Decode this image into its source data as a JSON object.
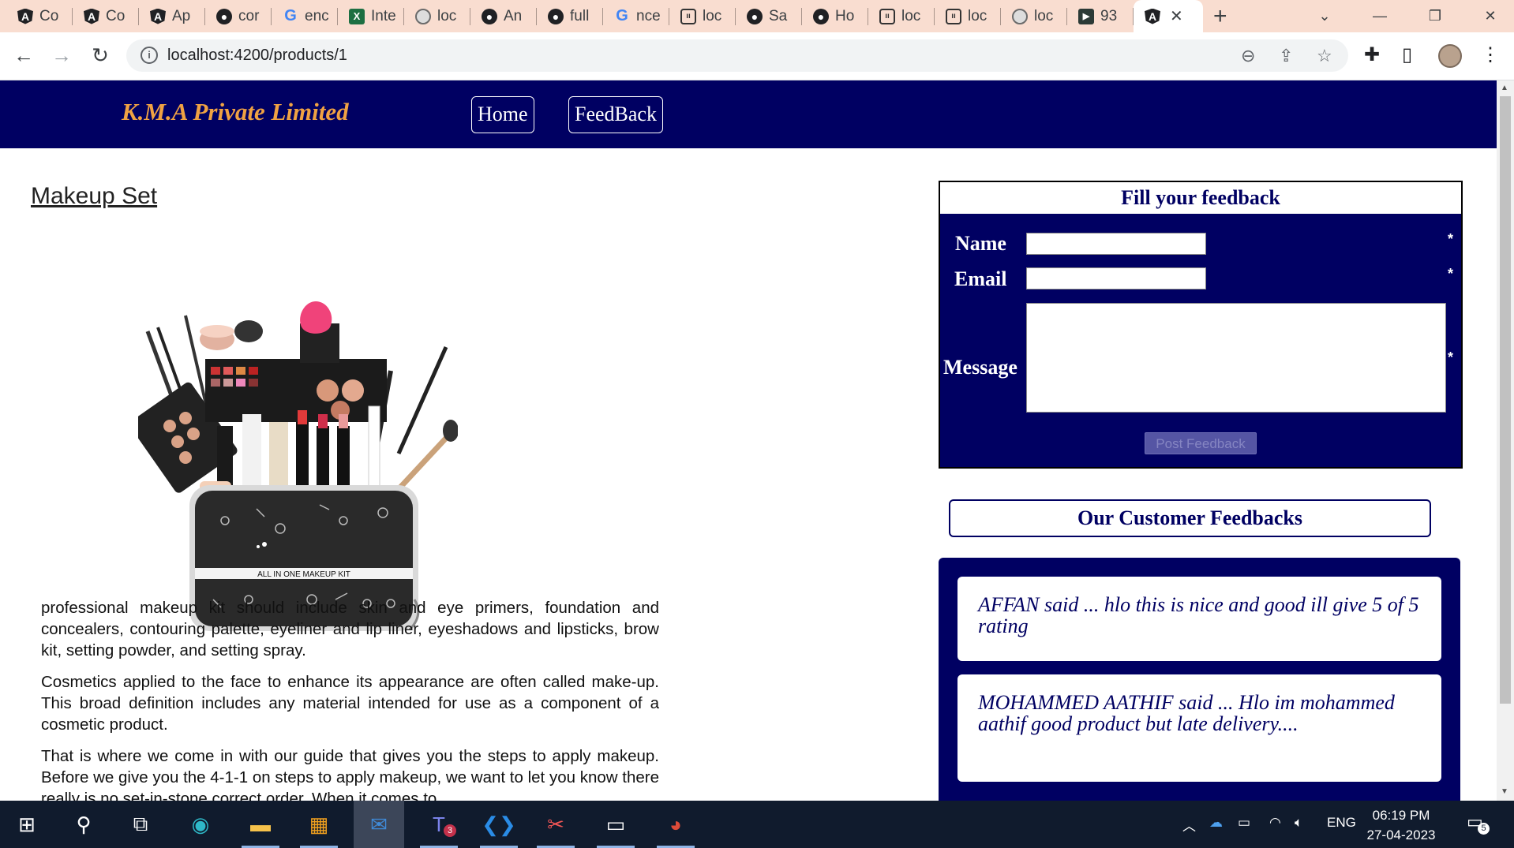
{
  "browser": {
    "tabs": [
      {
        "icon": "angular-icon",
        "label": "Co"
      },
      {
        "icon": "angular-icon",
        "label": "Co"
      },
      {
        "icon": "angular-icon",
        "label": "Ap"
      },
      {
        "icon": "github-icon",
        "label": "cor"
      },
      {
        "icon": "google-icon",
        "label": "enc"
      },
      {
        "icon": "excel-icon",
        "label": "Inte"
      },
      {
        "icon": "globe-icon",
        "label": "loc"
      },
      {
        "icon": "github-icon",
        "label": "An"
      },
      {
        "icon": "github-icon",
        "label": "full"
      },
      {
        "icon": "google-icon",
        "label": "nce"
      },
      {
        "icon": "robot-icon",
        "label": "loc"
      },
      {
        "icon": "github-icon",
        "label": "Sa"
      },
      {
        "icon": "github-icon",
        "label": "Ho"
      },
      {
        "icon": "robot-icon",
        "label": "loc"
      },
      {
        "icon": "robot-icon",
        "label": "loc"
      },
      {
        "icon": "globe-icon",
        "label": "loc"
      },
      {
        "icon": "app-icon",
        "label": "93"
      }
    ],
    "url": "localhost:4200/products/1"
  },
  "navbar": {
    "brand": "K.M.A Private Limited",
    "links": [
      "Home",
      "FeedBack"
    ]
  },
  "product": {
    "title": "Makeup Set",
    "image_caption": "ALL IN ONE MAKEUP KIT",
    "paragraphs": [
      "professional makeup kit should include skin and eye primers, foundation and concealers, contouring palette, eyeliner and lip liner, eyeshadows and lipsticks, brow kit, setting powder, and setting spray.",
      "Cosmetics applied to the face to enhance its appearance are often called make-up. This broad definition includes any material intended for use as a component of a cosmetic product.",
      "That is where we come in with our guide that gives you the steps to apply makeup. Before we give you the 4-1-1 on steps to apply makeup, we want to let you know there really is no set-in-stone correct order. When it comes to"
    ]
  },
  "feedback_form": {
    "title": "Fill your feedback",
    "name_label": "Name",
    "email_label": "Email",
    "message_label": "Message",
    "required_mark": "*",
    "submit_label": "Post Feedback"
  },
  "customer_feedbacks": {
    "heading": "Our Customer Feedbacks",
    "items": [
      "AFFAN said ... hlo this is nice and good ill give 5 of 5 rating",
      "MOHAMMED AATHIF said ... Hlo im mohammed aathif good product but late delivery...."
    ]
  },
  "taskbar": {
    "language": "ENG",
    "time": "06:19 PM",
    "date": "27-04-2023",
    "teams_badge": "3",
    "notification_count": "5"
  }
}
